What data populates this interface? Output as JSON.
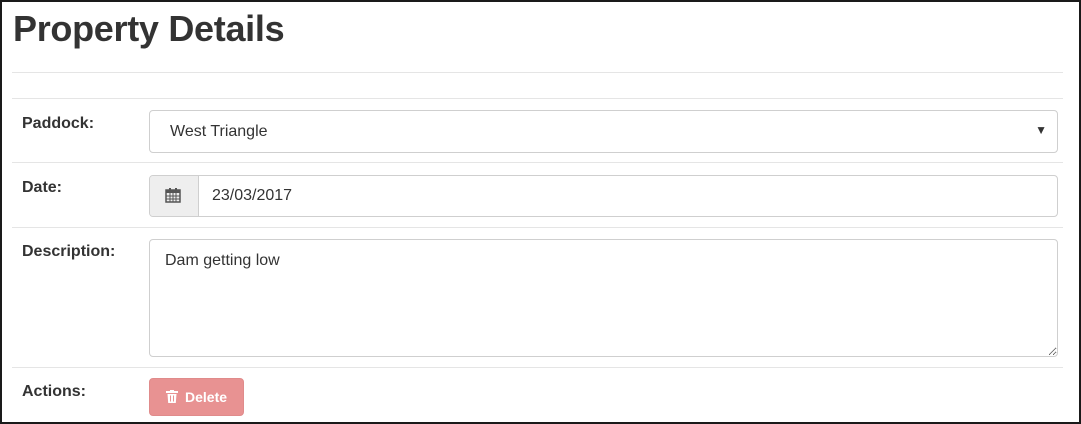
{
  "page": {
    "title": "Property Details"
  },
  "form": {
    "paddock": {
      "label": "Paddock:",
      "value": "West Triangle",
      "caret": "▼"
    },
    "date": {
      "label": "Date:",
      "value": "23/03/2017",
      "icon": "calendar-icon"
    },
    "description": {
      "label": "Description:",
      "value": "Dam getting low"
    },
    "actions": {
      "label": "Actions:",
      "delete_label": "Delete",
      "delete_icon": "trash-icon",
      "delete_color": "#e89292"
    }
  }
}
